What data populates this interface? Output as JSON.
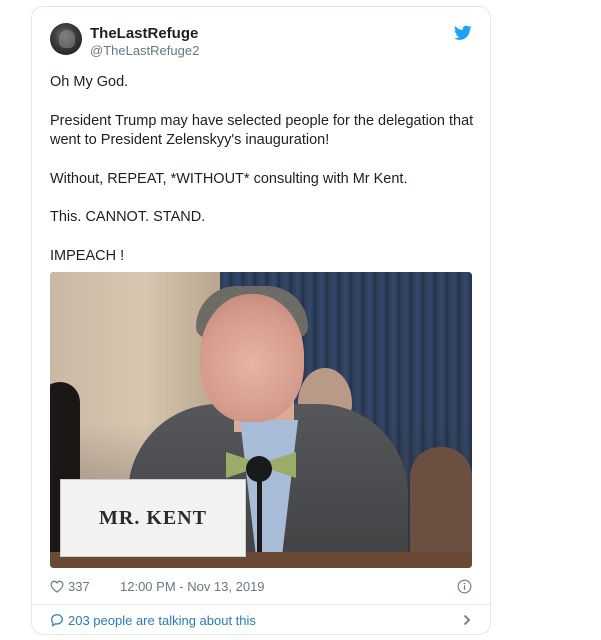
{
  "tweet": {
    "author": {
      "display_name": "TheLastRefuge",
      "handle": "@TheLastRefuge2"
    },
    "text_lines": [
      "Oh My God.",
      "President Trump may have selected people for the delegation that went to President Zelenskyy's inauguration!",
      "Without, REPEAT, *WITHOUT* consulting with Mr Kent.",
      "This. CANNOT. STAND.",
      "IMPEACH !"
    ],
    "media": {
      "nameplate_text": "MR. KENT"
    },
    "likes": "337",
    "timestamp": "12:00 PM - Nov 13, 2019",
    "conversation_text": "203 people are talking about this"
  },
  "icons": {
    "brand": "twitter-bird-icon",
    "like": "heart-icon",
    "info": "info-icon",
    "conversation": "speech-bubble-icon",
    "chevron": "chevron-right-icon"
  },
  "colors": {
    "brand_blue": "#1da1f2",
    "link_blue": "#2b7bb9",
    "muted_gray": "#697882",
    "text": "#1c2022",
    "border": "#e1e8ed"
  }
}
